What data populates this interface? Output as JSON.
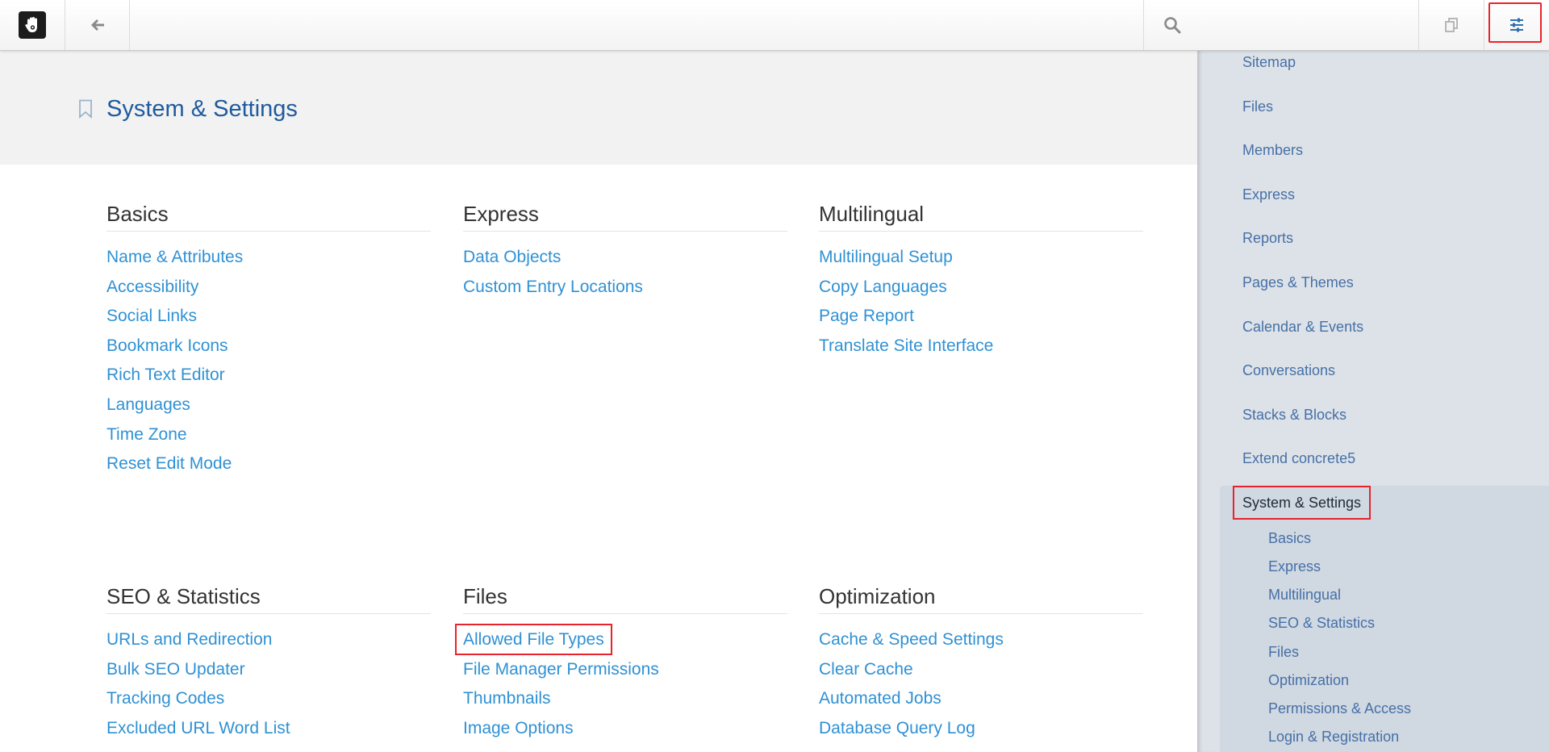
{
  "toolbar": {
    "logo_icon": "concrete5-hand-logo-icon",
    "back_icon": "arrow-left-icon",
    "search_icon": "search-icon",
    "search_value": "",
    "pages_icon": "sitemap-pages-icon",
    "settings_icon": "sliders-icon"
  },
  "page": {
    "title": "System & Settings",
    "bookmark_icon": "bookmark-icon"
  },
  "sections": {
    "basics": {
      "title": "Basics",
      "links": [
        "Name & Attributes",
        "Accessibility",
        "Social Links",
        "Bookmark Icons",
        "Rich Text Editor",
        "Languages",
        "Time Zone",
        "Reset Edit Mode"
      ]
    },
    "express": {
      "title": "Express",
      "links": [
        "Data Objects",
        "Custom Entry Locations"
      ]
    },
    "multilingual": {
      "title": "Multilingual",
      "links": [
        "Multilingual Setup",
        "Copy Languages",
        "Page Report",
        "Translate Site Interface"
      ]
    },
    "seo": {
      "title": "SEO & Statistics",
      "links": [
        "URLs and Redirection",
        "Bulk SEO Updater",
        "Tracking Codes",
        "Excluded URL Word List"
      ]
    },
    "files": {
      "title": "Files",
      "links": [
        "Allowed File Types",
        "File Manager Permissions",
        "Thumbnails",
        "Image Options"
      ]
    },
    "optimization": {
      "title": "Optimization",
      "links": [
        "Cache & Speed Settings",
        "Clear Cache",
        "Automated Jobs",
        "Database Query Log"
      ]
    }
  },
  "panel": {
    "items": [
      "Sitemap",
      "Files",
      "Members",
      "Express",
      "Reports",
      "Pages & Themes",
      "Calendar & Events",
      "Conversations",
      "Stacks & Blocks",
      "Extend concrete5"
    ],
    "active": "System & Settings",
    "subitems": [
      "Basics",
      "Express",
      "Multilingual",
      "SEO & Statistics",
      "Files",
      "Optimization",
      "Permissions & Access",
      "Login & Registration"
    ]
  }
}
